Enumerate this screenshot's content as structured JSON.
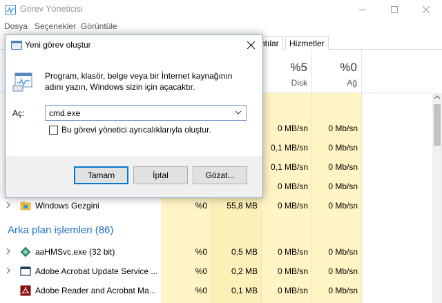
{
  "window": {
    "title": "Görev Yöneticisi",
    "icon": "task-manager-icon"
  },
  "menu": [
    "Dosya",
    "Seçenekler",
    "Görüntüle"
  ],
  "tabs": [
    {
      "label": "ntılar"
    },
    {
      "label": "Hizmetler"
    }
  ],
  "columns": {
    "disk": {
      "percent": "%5",
      "label": "Disk"
    },
    "network": {
      "percent": "%0",
      "label": "Ağ"
    }
  },
  "apps_rows": [
    {
      "disk": "0 MB/sn",
      "net": "0 Mb/sn"
    },
    {
      "disk": "0,1 MB/sn",
      "net": "0 Mb/sn"
    },
    {
      "disk": "0,1 MB/sn",
      "net": "0 Mb/sn"
    },
    {
      "disk": "0 MB/sn",
      "net": "0 Mb/sn"
    }
  ],
  "explorer_row": {
    "name": "Windows Gezgini",
    "cpu": "%0",
    "mem": "55,8 MB",
    "disk": "0 MB/sn",
    "net": "0 Mb/sn",
    "icon": "folder-icon"
  },
  "background_section": {
    "title": "Arka plan işlemleri (86)"
  },
  "background_rows": [
    {
      "name": "aaHMSvc.exe (32 bit)",
      "cpu": "%0",
      "mem": "0,5 MB",
      "disk": "0 MB/sn",
      "net": "0 Mb/sn",
      "icon": "service-diamond-icon"
    },
    {
      "name": "Adobe Acrobat Update Service ...",
      "cpu": "%0",
      "mem": "0,2 MB",
      "disk": "0 MB/sn",
      "net": "0 Mb/sn",
      "icon": "window-app-icon"
    },
    {
      "name": "Adobe Reader and Acrobat Ma...",
      "cpu": "%0",
      "mem": "0,1 MB",
      "disk": "0 MB/sn",
      "net": "0 Mb/sn",
      "icon": "acrobat-icon"
    }
  ],
  "dialog": {
    "title": "Yeni görev oluştur",
    "description": "Program, klasör, belge veya bir İnternet kaynağının adını yazın, Windows sizin için açacaktır.",
    "open_label": "Aç:",
    "input_value": "cmd.exe",
    "checkbox_label": "Bu görevi yönetici ayrıcalıklarıyla oluştur.",
    "checkbox_checked": false,
    "ok_label": "Tamam",
    "cancel_label": "İptal",
    "browse_label": "Gözat..."
  },
  "colors": {
    "accent": "#0078d7",
    "section_title": "#1e70c4",
    "heat_light": "#fff4c4",
    "heat_mem": "#fcefb8"
  }
}
